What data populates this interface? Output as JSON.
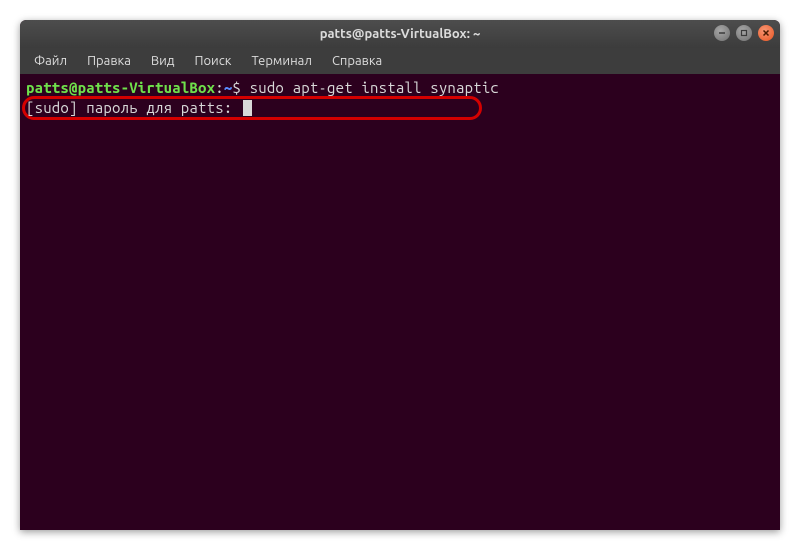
{
  "window": {
    "title": "patts@patts-VirtualBox: ~"
  },
  "menu": {
    "items": [
      "Файл",
      "Правка",
      "Вид",
      "Поиск",
      "Терминал",
      "Справка"
    ]
  },
  "terminal": {
    "prompt_user_host": "patts@patts-VirtualBox",
    "prompt_colon": ":",
    "prompt_path": "~",
    "prompt_dollar": "$ ",
    "command": "sudo apt-get install synaptic",
    "sudo_prompt": "[sudo] пароль для patts: "
  }
}
